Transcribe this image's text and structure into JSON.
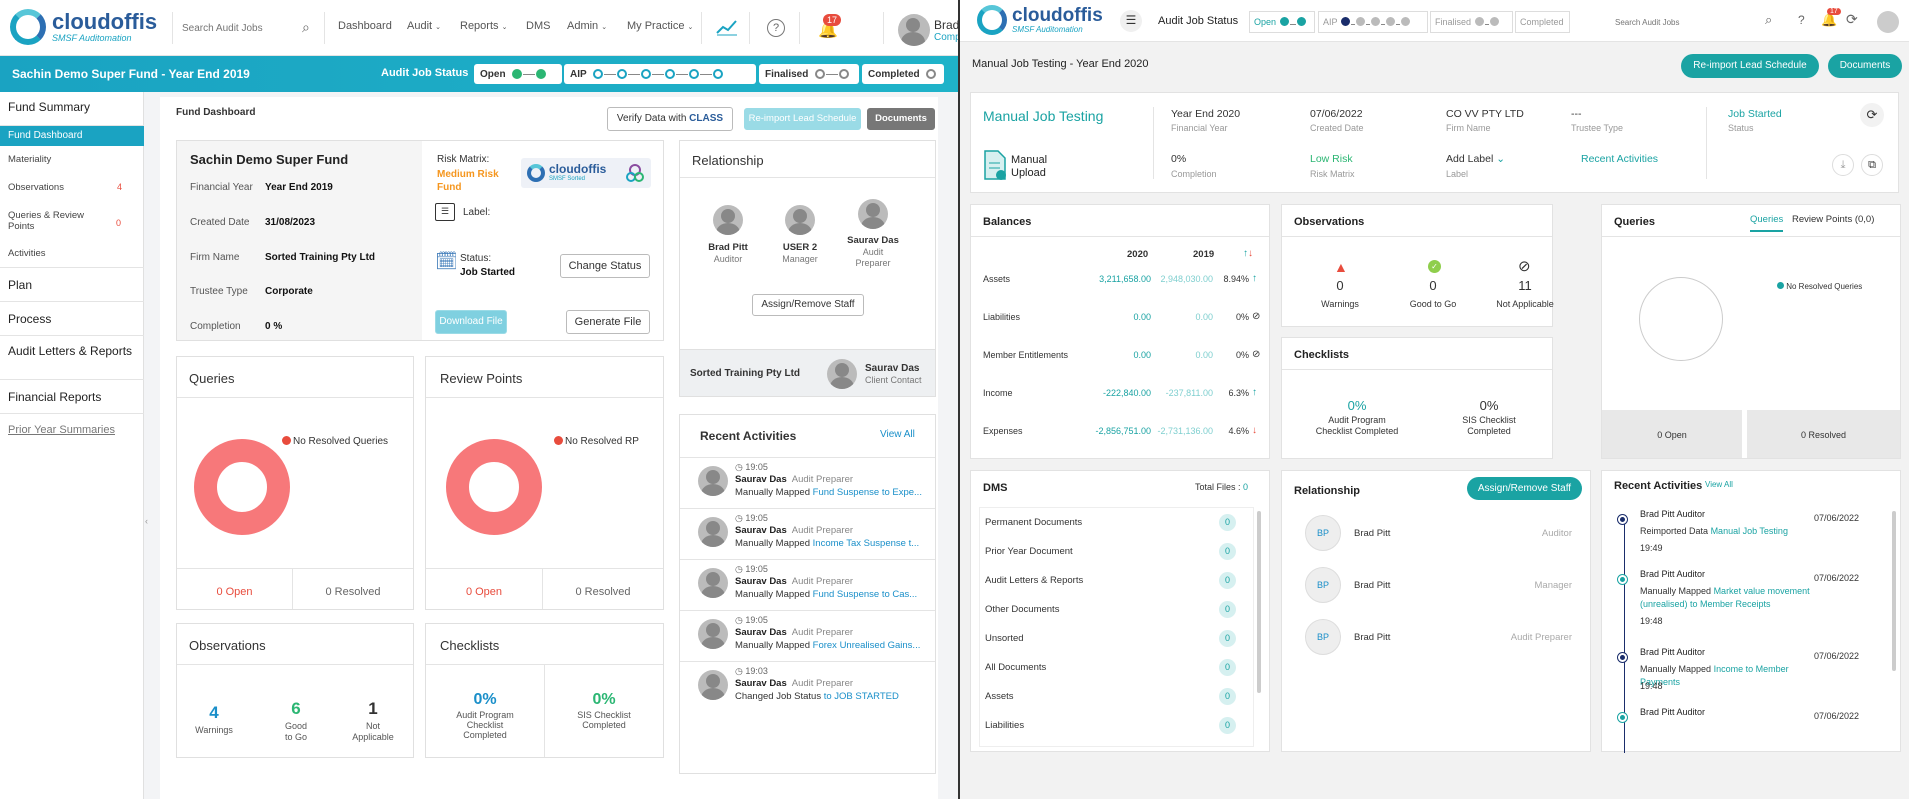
{
  "left": {
    "logo": {
      "name": "cloudoffis",
      "tag": "SMSF Auditomation"
    },
    "nav": {
      "search_placeholder": "Search Audit Jobs",
      "items": [
        "Dashboard",
        "Audit",
        "Reports",
        "DMS",
        "Admin",
        "My Practice"
      ],
      "notif_count": "17",
      "user": "Brad",
      "user_sub": "Comp"
    },
    "bar": {
      "title": "Sachin Demo Super Fund - Year End 2019",
      "status_label": "Audit Job Status",
      "stages": [
        "Open",
        "AIP",
        "Finalised",
        "Completed"
      ]
    },
    "sidebar": {
      "fund_summary": "Fund Summary",
      "fund_dashboard": "Fund Dashboard",
      "materiality": "Materiality",
      "observations": "Observations",
      "observations_count": "4",
      "queries": "Queries & Review Points",
      "queries_count": "0",
      "activities": "Activities",
      "plan": "Plan",
      "process": "Process",
      "letters": "Audit Letters & Reports",
      "financial": "Financial Reports",
      "prior": "Prior Year Summaries"
    },
    "dash": {
      "heading": "Fund Dashboard",
      "verify_btn": "Verify Data with",
      "verify_brand": "CLASS",
      "reimport_btn": "Re-import Lead Schedule",
      "documents_btn": "Documents"
    },
    "fund": {
      "name": "Sachin Demo Super Fund",
      "fy_label": "Financial Year",
      "fy": "Year End 2019",
      "created_label": "Created Date",
      "created": "31/08/2023",
      "firm_label": "Firm Name",
      "firm": "Sorted Training Pty Ltd",
      "trustee_label": "Trustee Type",
      "trustee": "Corporate",
      "completion_label": "Completion",
      "completion": "0 %",
      "risk_label": "Risk Matrix:",
      "risk": "Medium Risk Fund",
      "label_label": "Label:",
      "status_label": "Status:",
      "status": "Job Started",
      "change_status": "Change Status",
      "download": "Download File",
      "generate": "Generate File",
      "logo_name": "cloudoffis",
      "logo_tag": "SMSF Sorted"
    },
    "relationship": {
      "title": "Relationship",
      "people": [
        {
          "name": "Brad Pitt",
          "role": "Auditor"
        },
        {
          "name": "USER 2",
          "role": "Manager"
        },
        {
          "name": "Saurav Das",
          "role": "Audit Preparer"
        }
      ],
      "assign_btn": "Assign/Remove Staff",
      "client_firm": "Sorted Training Pty Ltd",
      "client_name": "Saurav Das",
      "client_role": "Client Contact"
    },
    "queries": {
      "title": "Queries",
      "legend": "No Resolved Queries",
      "open": "0 Open",
      "resolved": "0 Resolved"
    },
    "review": {
      "title": "Review Points",
      "legend": "No Resolved RP",
      "open": "0 Open",
      "resolved": "0 Resolved"
    },
    "observations": {
      "title": "Observations",
      "items": [
        {
          "value": "4",
          "label": "Warnings",
          "color": "#1a8fc9"
        },
        {
          "value": "6",
          "label": "Good to Go",
          "color": "#2bb673"
        },
        {
          "value": "1",
          "label": "Not Applicable",
          "color": "#333"
        }
      ]
    },
    "checklists": {
      "title": "Checklists",
      "items": [
        {
          "value": "0%",
          "label": "Audit Program Checklist Completed"
        },
        {
          "value": "0%",
          "label": "SIS Checklist Completed"
        }
      ]
    },
    "activities": {
      "title": "Recent Activities",
      "view_all": "View All",
      "items": [
        {
          "time": "19:05",
          "name": "Saurav Das",
          "role": "Audit Preparer",
          "text": "Manually Mapped",
          "link": "Fund Suspense to Expe..."
        },
        {
          "time": "19:05",
          "name": "Saurav Das",
          "role": "Audit Preparer",
          "text": "Manually Mapped",
          "link": "Income Tax Suspense t..."
        },
        {
          "time": "19:05",
          "name": "Saurav Das",
          "role": "Audit Preparer",
          "text": "Manually Mapped",
          "link": "Fund Suspense to Cas..."
        },
        {
          "time": "19:05",
          "name": "Saurav Das",
          "role": "Audit Preparer",
          "text": "Manually Mapped",
          "link": "Forex Unrealised Gains..."
        },
        {
          "time": "19:03",
          "name": "Saurav Das",
          "role": "Audit Preparer",
          "text": "Changed Job Status",
          "link": "to JOB STARTED"
        }
      ]
    }
  },
  "right": {
    "logo": {
      "name": "cloudoffis",
      "tag": "SMSF Auditomation"
    },
    "top": {
      "status_label": "Audit Job Status",
      "stages": [
        "Open",
        "AIP",
        "Finalised",
        "Completed"
      ],
      "search_placeholder": "Search Audit Jobs",
      "notif_count": "17"
    },
    "bar": {
      "title": "Manual Job Testing - Year End 2020",
      "reimport": "Re-import Lead Schedule",
      "documents": "Documents"
    },
    "info": {
      "name": "Manual Job Testing",
      "upload": "Manual Upload",
      "fy": "Year End 2020",
      "fy_label": "Financial Year",
      "created": "07/06/2022",
      "created_label": "Created Date",
      "firm": "CO VV PTY LTD",
      "firm_label": "Firm Name",
      "trustee": "---",
      "trustee_label": "Trustee Type",
      "status": "Job Started",
      "status_label": "Status",
      "completion": "0%",
      "completion_label": "Completion",
      "risk": "Low Risk",
      "risk_label": "Risk Matrix",
      "label": "Add Label",
      "label_label": "Label",
      "recent": "Recent Activities"
    },
    "balances": {
      "title": "Balances",
      "col1": "2020",
      "col2": "2019",
      "rows": [
        {
          "name": "Assets",
          "v1": "3,211,658.00",
          "v2": "2,948,030.00",
          "pct": "8.94%",
          "dir": "↑"
        },
        {
          "name": "Liabilities",
          "v1": "0.00",
          "v2": "0.00",
          "pct": "0%",
          "dir": "⊘"
        },
        {
          "name": "Member Entitlements",
          "v1": "0.00",
          "v2": "0.00",
          "pct": "0%",
          "dir": "⊘"
        },
        {
          "name": "Income",
          "v1": "-222,840.00",
          "v2": "-237,811.00",
          "pct": "6.3%",
          "dir": "↑"
        },
        {
          "name": "Expenses",
          "v1": "-2,856,751.00",
          "v2": "-2,731,136.00",
          "pct": "4.6%",
          "dir": "↓"
        }
      ]
    },
    "observations": {
      "title": "Observations",
      "items": [
        {
          "value": "0",
          "label": "Warnings"
        },
        {
          "value": "0",
          "label": "Good to Go"
        },
        {
          "value": "11",
          "label": "Not Applicable"
        }
      ]
    },
    "checklists": {
      "title": "Checklists",
      "items": [
        {
          "value": "0%",
          "label": "Audit Program Checklist Completed"
        },
        {
          "value": "0%",
          "label": "SIS Checklist Completed"
        }
      ]
    },
    "queries": {
      "title": "Queries",
      "tab1": "Queries",
      "tab2": "Review Points (0,0)",
      "legend": "No Resolved Queries",
      "open": "0 Open",
      "resolved": "0 Resolved"
    },
    "dms": {
      "title": "DMS",
      "total": "Total Files :",
      "total_count": "0",
      "items": [
        {
          "name": "Permanent Documents",
          "count": "0"
        },
        {
          "name": "Prior Year Document",
          "count": "0"
        },
        {
          "name": "Audit Letters & Reports",
          "count": "0"
        },
        {
          "name": "Other Documents",
          "count": "0"
        },
        {
          "name": "Unsorted",
          "count": "0"
        },
        {
          "name": "All Documents",
          "count": "0"
        },
        {
          "name": "Assets",
          "count": "0"
        },
        {
          "name": "Liabilities",
          "count": "0"
        }
      ]
    },
    "relationship": {
      "title": "Relationship",
      "assign": "Assign/Remove Staff",
      "people": [
        {
          "initials": "BP",
          "name": "Brad Pitt",
          "role": "Auditor"
        },
        {
          "initials": "BP",
          "name": "Brad Pitt",
          "role": "Manager"
        },
        {
          "initials": "BP",
          "name": "Brad Pitt",
          "role": "Audit Preparer"
        }
      ]
    },
    "activities": {
      "title": "Recent Activities",
      "view_all": "View All",
      "items": [
        {
          "who": "Brad Pitt Auditor",
          "date": "07/06/2022",
          "text": "Reimported Data",
          "link": "Manual Job Testing",
          "time": "19:49",
          "color": "#1a2d6b"
        },
        {
          "who": "Brad Pitt Auditor",
          "date": "07/06/2022",
          "text": "Manually Mapped",
          "link": "Market value movement (unrealised) to Member Receipts",
          "time": "19:48",
          "color": "#1aa3a3"
        },
        {
          "who": "Brad Pitt Auditor",
          "date": "07/06/2022",
          "text": "Manually Mapped",
          "link": "Income to Member Payments",
          "time": "19:48",
          "color": "#1a2d6b"
        },
        {
          "who": "Brad Pitt Auditor",
          "date": "07/06/2022",
          "text": "",
          "link": "",
          "time": "",
          "color": "#1aa3a3"
        }
      ]
    }
  }
}
